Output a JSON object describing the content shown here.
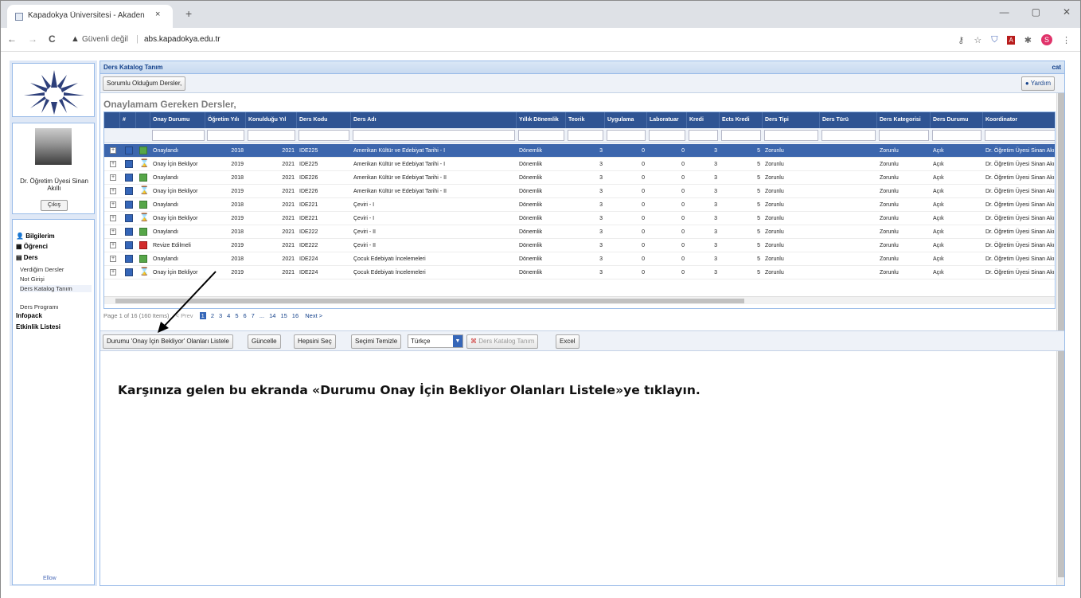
{
  "browser": {
    "tab_title": "Kapadokya Üniversitesi - Akaden",
    "tab_close": "×",
    "new_tab": "+",
    "window_controls": [
      "—",
      "▢",
      "✕"
    ],
    "nav": {
      "back": "←",
      "forward": "→",
      "reload": "C"
    },
    "security_icon": "warning-icon",
    "security_text": "Güvenli değil",
    "separator": "|",
    "url": "abs.kapadokya.edu.tr",
    "profile_initial": "S"
  },
  "sidebar": {
    "user_name": "Dr. Öğretim Üyesi Sinan Akıllı",
    "logout_label": "Çıkış",
    "menu": {
      "bilgilerim": "Bilgilerim",
      "ogrenci": "Öğrenci",
      "ders": "Ders",
      "ders_sub": [
        "Verdiğim Dersler",
        "Not Girişi",
        "Ders Katalog Tanım",
        "Ders Programı"
      ],
      "infopack": "Infopack",
      "etkinlik": "Etkinlik Listesi"
    },
    "footer": "Ellow"
  },
  "panel": {
    "title": "Ders Katalog Tanım",
    "right_text": "cat",
    "tab_button": "Sorumlu Olduğum Dersler,",
    "help_button": "Yardım",
    "section_title": "Onaylamam Gereken Dersler,"
  },
  "grid": {
    "headers": [
      "#",
      "Onay Durumu",
      "Öğretim Yılı",
      "Konulduğu Yıl",
      "Ders Kodu",
      "Ders Adı",
      "Yıllık Dönemlik",
      "Teorik",
      "Uygulama",
      "Laboratuar",
      "Kredi",
      "Ects Kredi",
      "Ders Tipi",
      "Ders Türü",
      "Ders Kategorisi",
      "Ders Durumu",
      "Koordinator"
    ],
    "rows": [
      {
        "status_icon": "ok",
        "status": "Onaylandı",
        "year": "2018",
        "set_year": "2021",
        "code": "IDE225",
        "name": "Amerikan Kültür ve Edebiyat Tarihi - I",
        "period": "Dönemlik",
        "teorik": "3",
        "uygulama": "0",
        "lab": "0",
        "kredi": "3",
        "ects": "5",
        "tip": "Zorunlu",
        "tur": "",
        "kategori": "Zorunlu",
        "durum": "Açık",
        "koordinator": "Dr. Öğretim Üyesi Sinan Akıllı"
      },
      {
        "status_icon": "wait",
        "status": "Onay İçin Bekliyor",
        "year": "2019",
        "set_year": "2021",
        "code": "IDE225",
        "name": "Amerikan Kültür ve Edebiyat Tarihi - I",
        "period": "Dönemlik",
        "teorik": "3",
        "uygulama": "0",
        "lab": "0",
        "kredi": "3",
        "ects": "5",
        "tip": "Zorunlu",
        "tur": "",
        "kategori": "Zorunlu",
        "durum": "Açık",
        "koordinator": "Dr. Öğretim Üyesi Sinan Akıllı"
      },
      {
        "status_icon": "ok",
        "status": "Onaylandı",
        "year": "2018",
        "set_year": "2021",
        "code": "IDE226",
        "name": "Amerikan Kültür ve Edebiyat Tarihi - II",
        "period": "Dönemlik",
        "teorik": "3",
        "uygulama": "0",
        "lab": "0",
        "kredi": "3",
        "ects": "5",
        "tip": "Zorunlu",
        "tur": "",
        "kategori": "Zorunlu",
        "durum": "Açık",
        "koordinator": "Dr. Öğretim Üyesi Sinan Akıllı"
      },
      {
        "status_icon": "wait",
        "status": "Onay İçin Bekliyor",
        "year": "2019",
        "set_year": "2021",
        "code": "IDE226",
        "name": "Amerikan Kültür ve Edebiyat Tarihi - II",
        "period": "Dönemlik",
        "teorik": "3",
        "uygulama": "0",
        "lab": "0",
        "kredi": "3",
        "ects": "5",
        "tip": "Zorunlu",
        "tur": "",
        "kategori": "Zorunlu",
        "durum": "Açık",
        "koordinator": "Dr. Öğretim Üyesi Sinan Akıllı"
      },
      {
        "status_icon": "ok",
        "status": "Onaylandı",
        "year": "2018",
        "set_year": "2021",
        "code": "IDE221",
        "name": "Çeviri - I",
        "period": "Dönemlik",
        "teorik": "3",
        "uygulama": "0",
        "lab": "0",
        "kredi": "3",
        "ects": "5",
        "tip": "Zorunlu",
        "tur": "",
        "kategori": "Zorunlu",
        "durum": "Açık",
        "koordinator": "Dr. Öğretim Üyesi Sinan Akıllı"
      },
      {
        "status_icon": "wait",
        "status": "Onay İçin Bekliyor",
        "year": "2019",
        "set_year": "2021",
        "code": "IDE221",
        "name": "Çeviri - I",
        "period": "Dönemlik",
        "teorik": "3",
        "uygulama": "0",
        "lab": "0",
        "kredi": "3",
        "ects": "5",
        "tip": "Zorunlu",
        "tur": "",
        "kategori": "Zorunlu",
        "durum": "Açık",
        "koordinator": "Dr. Öğretim Üyesi Sinan Akıllı"
      },
      {
        "status_icon": "ok",
        "status": "Onaylandı",
        "year": "2018",
        "set_year": "2021",
        "code": "IDE222",
        "name": "Çeviri - II",
        "period": "Dönemlik",
        "teorik": "3",
        "uygulama": "0",
        "lab": "0",
        "kredi": "3",
        "ects": "5",
        "tip": "Zorunlu",
        "tur": "",
        "kategori": "Zorunlu",
        "durum": "Açık",
        "koordinator": "Dr. Öğretim Üyesi Sinan Akıllı"
      },
      {
        "status_icon": "rev",
        "status": "Revize Edilmeli",
        "year": "2019",
        "set_year": "2021",
        "code": "IDE222",
        "name": "Çeviri - II",
        "period": "Dönemlik",
        "teorik": "3",
        "uygulama": "0",
        "lab": "0",
        "kredi": "3",
        "ects": "5",
        "tip": "Zorunlu",
        "tur": "",
        "kategori": "Zorunlu",
        "durum": "Açık",
        "koordinator": "Dr. Öğretim Üyesi Sinan Akıllı"
      },
      {
        "status_icon": "ok",
        "status": "Onaylandı",
        "year": "2018",
        "set_year": "2021",
        "code": "IDE224",
        "name": "Çocuk Edebiyatı İncelemeleri",
        "period": "Dönemlik",
        "teorik": "3",
        "uygulama": "0",
        "lab": "0",
        "kredi": "3",
        "ects": "5",
        "tip": "Zorunlu",
        "tur": "",
        "kategori": "Zorunlu",
        "durum": "Açık",
        "koordinator": "Dr. Öğretim Üyesi Sinan Akıllı"
      },
      {
        "status_icon": "wait",
        "status": "Onay İçin Bekliyor",
        "year": "2019",
        "set_year": "2021",
        "code": "IDE224",
        "name": "Çocuk Edebiyatı İncelemeleri",
        "period": "Dönemlik",
        "teorik": "3",
        "uygulama": "0",
        "lab": "0",
        "kredi": "3",
        "ects": "5",
        "tip": "Zorunlu",
        "tur": "",
        "kategori": "Zorunlu",
        "durum": "Açık",
        "koordinator": "Dr. Öğretim Üyesi Sinan Akıllı"
      }
    ]
  },
  "pager": {
    "info": "Page 1 of 16 (160 Items)",
    "prev": "< Prev",
    "pages": [
      "1",
      "2",
      "3",
      "4",
      "5",
      "6",
      "7",
      "...",
      "14",
      "15",
      "16"
    ],
    "next": "Next >"
  },
  "bottom_toolbar": {
    "list_waiting": "Durumu 'Onay İçin Bekliyor' Olanları Listele",
    "update": "Güncelle",
    "select_all": "Hepsini Seç",
    "clear_selection": "Seçimi Temizle",
    "language": "Türkçe",
    "catalog": "Ders Katalog Tanım",
    "excel": "Excel"
  },
  "instruction": "Karşınıza gelen bu ekranda «Durumu Onay İçin Bekliyor Olanları Listele»ye tıklayın.",
  "colors": {
    "grid_header": "#2f5493",
    "selected_row": "#3c66ad",
    "panel_border": "#99bbe8"
  }
}
